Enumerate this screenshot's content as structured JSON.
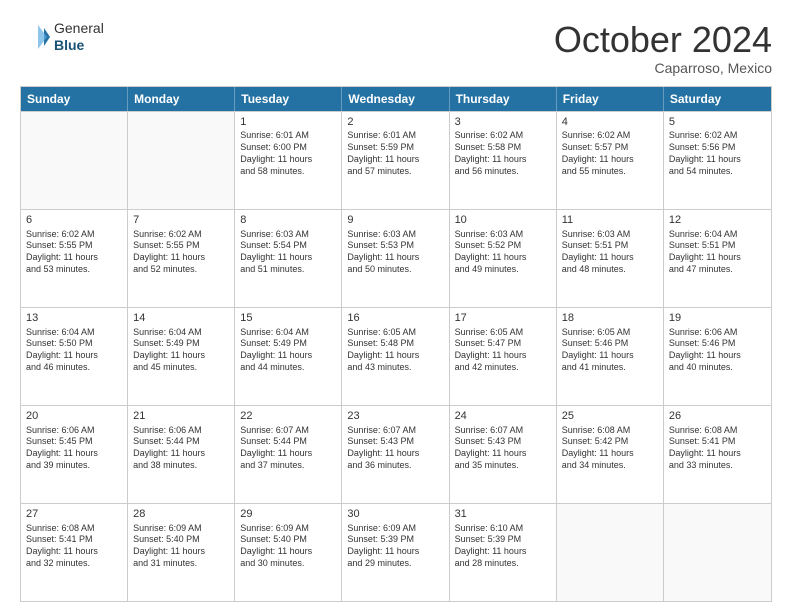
{
  "header": {
    "logo_general": "General",
    "logo_blue": "Blue",
    "month": "October 2024",
    "location": "Caparroso, Mexico"
  },
  "weekdays": [
    "Sunday",
    "Monday",
    "Tuesday",
    "Wednesday",
    "Thursday",
    "Friday",
    "Saturday"
  ],
  "rows": [
    [
      {
        "day": "",
        "info": ""
      },
      {
        "day": "",
        "info": ""
      },
      {
        "day": "1",
        "info": "Sunrise: 6:01 AM\nSunset: 6:00 PM\nDaylight: 11 hours\nand 58 minutes."
      },
      {
        "day": "2",
        "info": "Sunrise: 6:01 AM\nSunset: 5:59 PM\nDaylight: 11 hours\nand 57 minutes."
      },
      {
        "day": "3",
        "info": "Sunrise: 6:02 AM\nSunset: 5:58 PM\nDaylight: 11 hours\nand 56 minutes."
      },
      {
        "day": "4",
        "info": "Sunrise: 6:02 AM\nSunset: 5:57 PM\nDaylight: 11 hours\nand 55 minutes."
      },
      {
        "day": "5",
        "info": "Sunrise: 6:02 AM\nSunset: 5:56 PM\nDaylight: 11 hours\nand 54 minutes."
      }
    ],
    [
      {
        "day": "6",
        "info": "Sunrise: 6:02 AM\nSunset: 5:55 PM\nDaylight: 11 hours\nand 53 minutes."
      },
      {
        "day": "7",
        "info": "Sunrise: 6:02 AM\nSunset: 5:55 PM\nDaylight: 11 hours\nand 52 minutes."
      },
      {
        "day": "8",
        "info": "Sunrise: 6:03 AM\nSunset: 5:54 PM\nDaylight: 11 hours\nand 51 minutes."
      },
      {
        "day": "9",
        "info": "Sunrise: 6:03 AM\nSunset: 5:53 PM\nDaylight: 11 hours\nand 50 minutes."
      },
      {
        "day": "10",
        "info": "Sunrise: 6:03 AM\nSunset: 5:52 PM\nDaylight: 11 hours\nand 49 minutes."
      },
      {
        "day": "11",
        "info": "Sunrise: 6:03 AM\nSunset: 5:51 PM\nDaylight: 11 hours\nand 48 minutes."
      },
      {
        "day": "12",
        "info": "Sunrise: 6:04 AM\nSunset: 5:51 PM\nDaylight: 11 hours\nand 47 minutes."
      }
    ],
    [
      {
        "day": "13",
        "info": "Sunrise: 6:04 AM\nSunset: 5:50 PM\nDaylight: 11 hours\nand 46 minutes."
      },
      {
        "day": "14",
        "info": "Sunrise: 6:04 AM\nSunset: 5:49 PM\nDaylight: 11 hours\nand 45 minutes."
      },
      {
        "day": "15",
        "info": "Sunrise: 6:04 AM\nSunset: 5:49 PM\nDaylight: 11 hours\nand 44 minutes."
      },
      {
        "day": "16",
        "info": "Sunrise: 6:05 AM\nSunset: 5:48 PM\nDaylight: 11 hours\nand 43 minutes."
      },
      {
        "day": "17",
        "info": "Sunrise: 6:05 AM\nSunset: 5:47 PM\nDaylight: 11 hours\nand 42 minutes."
      },
      {
        "day": "18",
        "info": "Sunrise: 6:05 AM\nSunset: 5:46 PM\nDaylight: 11 hours\nand 41 minutes."
      },
      {
        "day": "19",
        "info": "Sunrise: 6:06 AM\nSunset: 5:46 PM\nDaylight: 11 hours\nand 40 minutes."
      }
    ],
    [
      {
        "day": "20",
        "info": "Sunrise: 6:06 AM\nSunset: 5:45 PM\nDaylight: 11 hours\nand 39 minutes."
      },
      {
        "day": "21",
        "info": "Sunrise: 6:06 AM\nSunset: 5:44 PM\nDaylight: 11 hours\nand 38 minutes."
      },
      {
        "day": "22",
        "info": "Sunrise: 6:07 AM\nSunset: 5:44 PM\nDaylight: 11 hours\nand 37 minutes."
      },
      {
        "day": "23",
        "info": "Sunrise: 6:07 AM\nSunset: 5:43 PM\nDaylight: 11 hours\nand 36 minutes."
      },
      {
        "day": "24",
        "info": "Sunrise: 6:07 AM\nSunset: 5:43 PM\nDaylight: 11 hours\nand 35 minutes."
      },
      {
        "day": "25",
        "info": "Sunrise: 6:08 AM\nSunset: 5:42 PM\nDaylight: 11 hours\nand 34 minutes."
      },
      {
        "day": "26",
        "info": "Sunrise: 6:08 AM\nSunset: 5:41 PM\nDaylight: 11 hours\nand 33 minutes."
      }
    ],
    [
      {
        "day": "27",
        "info": "Sunrise: 6:08 AM\nSunset: 5:41 PM\nDaylight: 11 hours\nand 32 minutes."
      },
      {
        "day": "28",
        "info": "Sunrise: 6:09 AM\nSunset: 5:40 PM\nDaylight: 11 hours\nand 31 minutes."
      },
      {
        "day": "29",
        "info": "Sunrise: 6:09 AM\nSunset: 5:40 PM\nDaylight: 11 hours\nand 30 minutes."
      },
      {
        "day": "30",
        "info": "Sunrise: 6:09 AM\nSunset: 5:39 PM\nDaylight: 11 hours\nand 29 minutes."
      },
      {
        "day": "31",
        "info": "Sunrise: 6:10 AM\nSunset: 5:39 PM\nDaylight: 11 hours\nand 28 minutes."
      },
      {
        "day": "",
        "info": ""
      },
      {
        "day": "",
        "info": ""
      }
    ]
  ]
}
